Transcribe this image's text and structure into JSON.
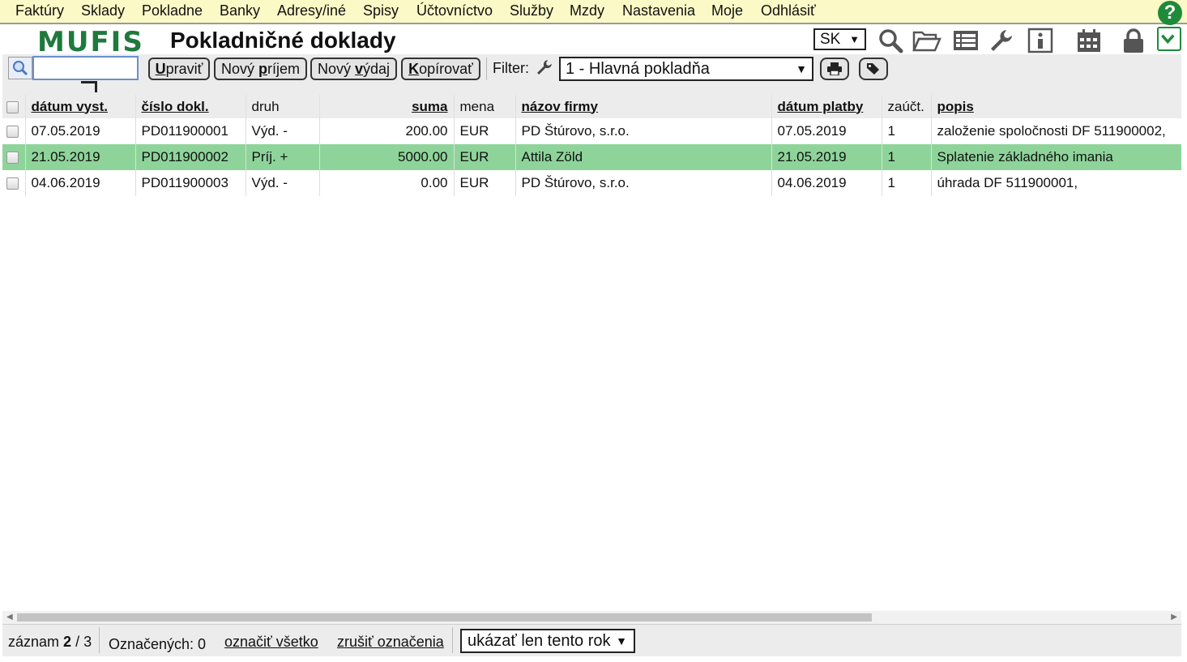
{
  "menu": [
    "Faktúry",
    "Sklady",
    "Pokladne",
    "Banky",
    "Adresy/iné",
    "Spisy",
    "Účtovníctvo",
    "Služby",
    "Mzdy",
    "Nastavenia",
    "Moje",
    "Odhlásiť"
  ],
  "header": {
    "logo": "MUFIS",
    "title": "Pokladničné doklady",
    "language": "SK",
    "help": "?"
  },
  "icons": [
    "search-icon",
    "folder-open-icon",
    "list-icon",
    "wrench-icon",
    "info-icon",
    "calendar-icon",
    "lock-icon"
  ],
  "toolbar": {
    "search_value": "",
    "edit": {
      "pre": "",
      "key": "U",
      "post": "praviť"
    },
    "new_income": {
      "pre": "Nový ",
      "key": "p",
      "post": "ríjem"
    },
    "new_expense": {
      "pre": "Nový ",
      "key": "v",
      "post": "ýdaj"
    },
    "copy": {
      "pre": "",
      "key": "K",
      "post": "opírovať"
    },
    "filter_label": "Filter:",
    "filter_value": "1 - Hlavná pokladňa"
  },
  "table": {
    "columns": [
      "dátum vyst.",
      "číslo dokl.",
      "druh",
      "suma",
      "mena",
      "názov firmy",
      "dátum platby",
      "zaúčt.",
      "popis"
    ],
    "rows": [
      {
        "date": "07.05.2019",
        "number": "PD011900001",
        "kind": "Výd. -",
        "amount": "200.00",
        "currency": "EUR",
        "company": "PD Štúrovo, s.r.o.",
        "pay_date": "07.05.2019",
        "posted": "1",
        "desc": "založenie spoločnosti DF 511900002,",
        "selected": false
      },
      {
        "date": "21.05.2019",
        "number": "PD011900002",
        "kind": "Príj. +",
        "amount": "5000.00",
        "currency": "EUR",
        "company": "Attila Zöld",
        "pay_date": "21.05.2019",
        "posted": "1",
        "desc": "Splatenie základného imania",
        "selected": true
      },
      {
        "date": "04.06.2019",
        "number": "PD011900003",
        "kind": "Výd. -",
        "amount": "0.00",
        "currency": "EUR",
        "company": "PD Štúrovo, s.r.o.",
        "pay_date": "04.06.2019",
        "posted": "1",
        "desc": "úhrada DF 511900001,",
        "selected": false
      }
    ]
  },
  "status": {
    "record_label": "záznam",
    "record_current": "2",
    "record_total": "/ 3",
    "marked": "Označených: 0",
    "mark_all": "označiť všetko",
    "unmark": "zrušiť označenia",
    "year_filter": "ukázať len tento rok"
  },
  "colors": {
    "menu_bg": "#fbf9c6",
    "accent_green": "#1f8a3a",
    "selected_row": "#8ed49a"
  }
}
